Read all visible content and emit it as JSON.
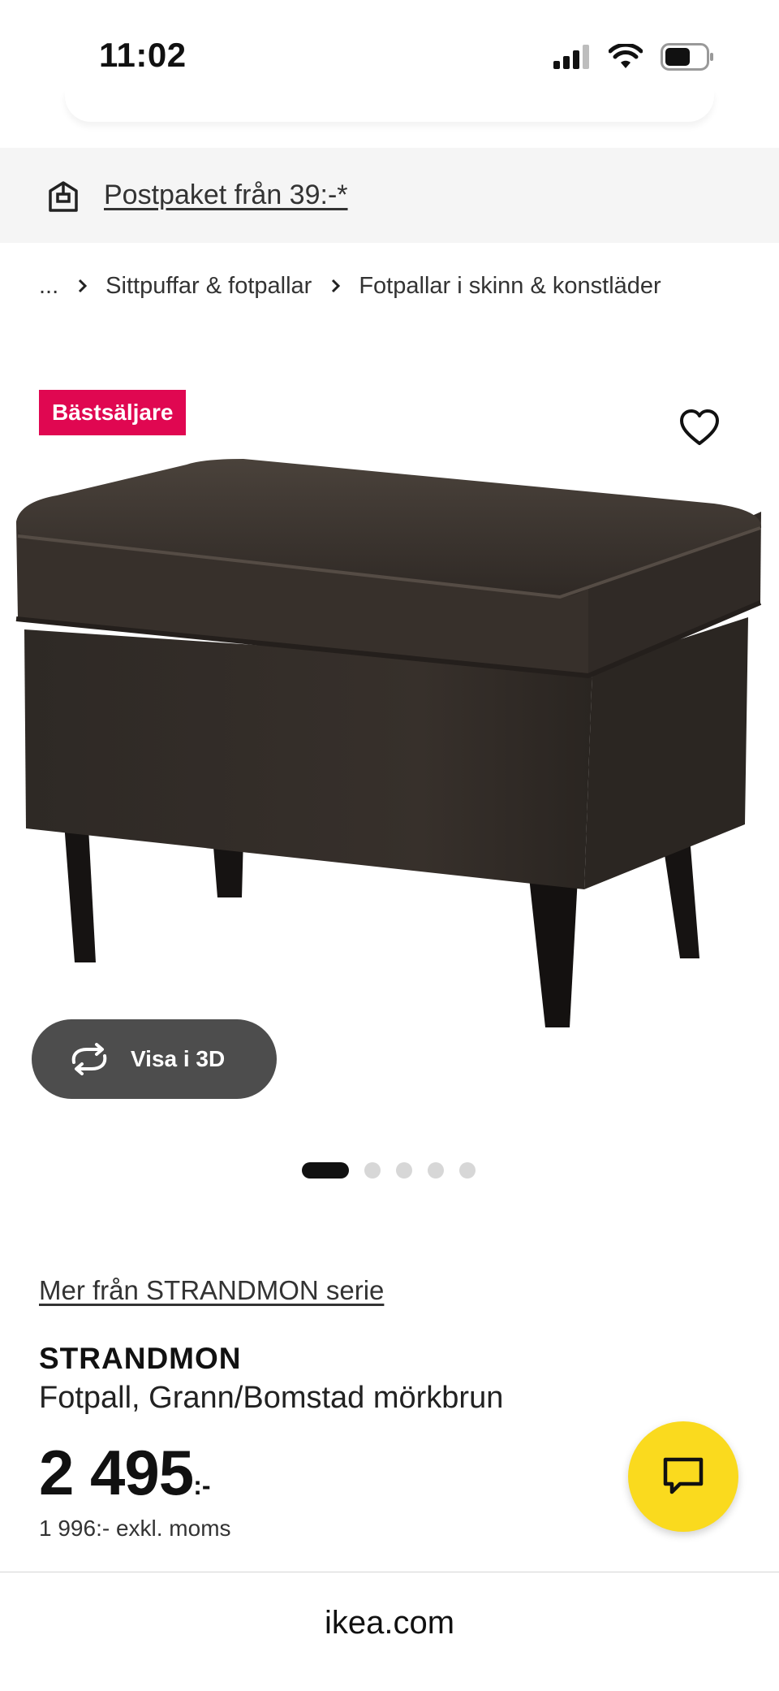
{
  "status_bar": {
    "time": "11:02"
  },
  "promo": {
    "label": "Postpaket från 39:-*"
  },
  "breadcrumb": {
    "items": [
      "...",
      "Sittpuffar & fotpallar",
      "Fotpallar i skinn & konstläder"
    ]
  },
  "product_image": {
    "badge": "Bästsäljare",
    "view_3d_label": "Visa i 3D",
    "carousel_count": 5,
    "carousel_active": 1
  },
  "product": {
    "series_link": "Mer från STRANDMON serie",
    "name": "STRANDMON",
    "description": "Fotpall, Grann/Bomstad mörkbrun",
    "price": "2 495",
    "price_suffix": ":-",
    "price_excl_vat": "1 996:- exkl. moms"
  },
  "browser": {
    "url": "ikea.com"
  },
  "colors": {
    "badge": "#e00751",
    "chat_button": "#fada1e",
    "view_3d_button": "#4d4d4d",
    "banner_bg": "#f5f5f5"
  },
  "icons": [
    "signal-icon",
    "wifi-icon",
    "battery-icon",
    "parcel-icon",
    "chevron-right-icon",
    "heart-icon",
    "rotate-3d-icon",
    "chat-icon"
  ]
}
